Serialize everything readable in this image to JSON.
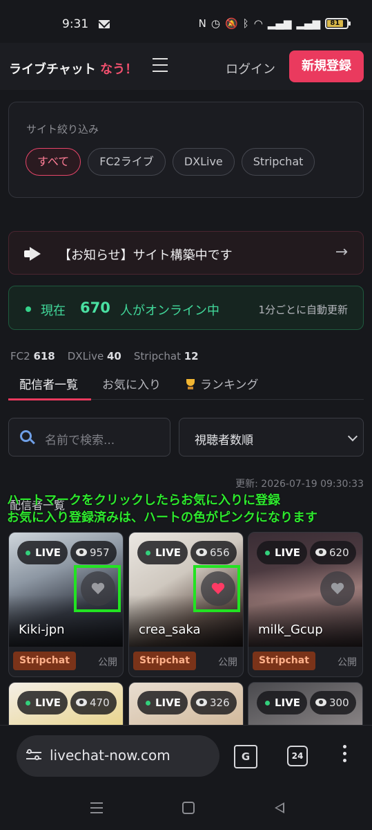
{
  "status_bar": {
    "time": "9:31",
    "battery": "81"
  },
  "header": {
    "brand": "ライブチャット",
    "brand_accent": "なう！",
    "login": "ログイン",
    "register": "新規登録"
  },
  "filter": {
    "title": "サイト絞り込み",
    "chips": [
      "すべて",
      "FC2ライブ",
      "DXLive",
      "Stripchat"
    ],
    "active": "すべて"
  },
  "notice": {
    "text": "【お知らせ】サイト構築中です",
    "arrow": "→"
  },
  "online": {
    "prefix": "現在",
    "count": "670",
    "suffix": "人がオンライン中",
    "auto_update": "1分ごとに自動更新"
  },
  "counts": [
    {
      "name": "FC2",
      "value": "618"
    },
    {
      "name": "DXLive",
      "value": "40"
    },
    {
      "name": "Stripchat",
      "value": "12"
    }
  ],
  "tabs": [
    "配信者一覧",
    "お気に入り",
    "ランキング"
  ],
  "search": {
    "placeholder": "名前で検索..."
  },
  "sort": {
    "value": "視聴者数順"
  },
  "updated": "更新: 2026-07-19 09:30:33",
  "section_heading": "配信者一覧",
  "overlay_note": [
    "ハートマークをクリックしたらお気に入りに登録",
    "お気に入り登録済みは、ハートの色がピンクになります"
  ],
  "cards": [
    {
      "live": "LIVE",
      "views": "957",
      "name": "Kiki-jpn",
      "platform": "Stripchat",
      "visibility": "公開",
      "favorited": false
    },
    {
      "live": "LIVE",
      "views": "656",
      "name": "crea_saka",
      "platform": "Stripchat",
      "visibility": "公開",
      "favorited": true
    },
    {
      "live": "LIVE",
      "views": "620",
      "name": "milk_Gcup",
      "platform": "Stripchat",
      "visibility": "公開",
      "favorited": false
    },
    {
      "live": "LIVE",
      "views": "470"
    },
    {
      "live": "LIVE",
      "views": "326"
    },
    {
      "live": "LIVE",
      "views": "300"
    }
  ],
  "browser": {
    "url": "livechat-now.com",
    "tab_count": "24"
  },
  "colors": {
    "accent": "#ea3a5e",
    "online_green": "#41d89a",
    "highlight": "#22e322"
  }
}
